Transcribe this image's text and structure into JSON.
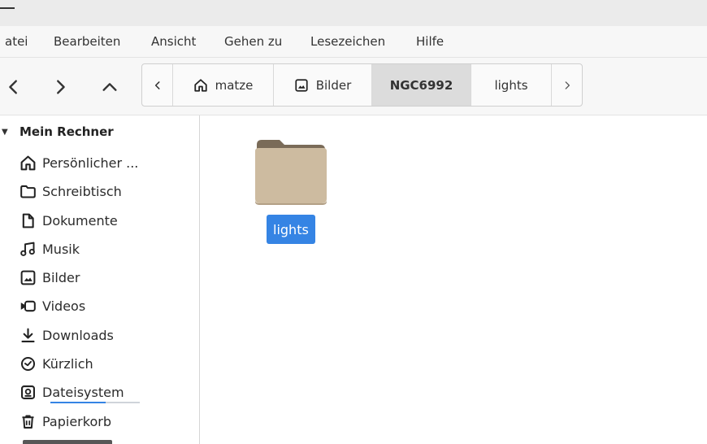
{
  "menubar": {
    "items": [
      "atei",
      "Bearbeiten",
      "Ansicht",
      "Gehen zu",
      "Lesezeichen",
      "Hilfe"
    ]
  },
  "pathbar": {
    "crumbs": [
      "matze",
      "Bilder",
      "NGC6992",
      "lights"
    ],
    "active": "NGC6992"
  },
  "sidebar": {
    "section": "Mein Rechner",
    "items": [
      {
        "label": "Persönlicher ...",
        "icon": "home-icon"
      },
      {
        "label": "Schreibtisch",
        "icon": "folder-icon"
      },
      {
        "label": "Dokumente",
        "icon": "document-icon"
      },
      {
        "label": "Musik",
        "icon": "music-icon"
      },
      {
        "label": "Bilder",
        "icon": "image-icon"
      },
      {
        "label": "Videos",
        "icon": "video-icon"
      },
      {
        "label": "Downloads",
        "icon": "download-icon"
      },
      {
        "label": "Kürzlich",
        "icon": "clock-icon"
      },
      {
        "label": "Dateisystem",
        "icon": "drive-icon"
      },
      {
        "label": "Papierkorb",
        "icon": "trash-icon"
      }
    ],
    "filesystem_usage_fraction": 0.62
  },
  "content": {
    "items": [
      {
        "name": "lights",
        "type": "folder",
        "selected": true
      }
    ]
  },
  "colors": {
    "selection": "#3584e4",
    "folder_front": "#cdbba0",
    "folder_back": "#7a6b58"
  }
}
